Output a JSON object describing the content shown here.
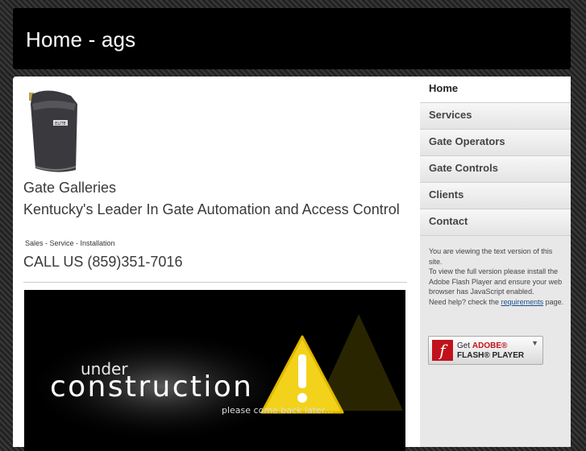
{
  "header": {
    "title": "Home - ags"
  },
  "main": {
    "heading": "Gate Galleries",
    "tagline": "Kentucky's Leader In Gate Automation and Access Control",
    "services_line": "Sales - Service - Installation",
    "phone": "CALL US (859)351-7016",
    "banner": {
      "line1": "under",
      "line2": "construction",
      "line3": "please come back later..."
    }
  },
  "sidebar": {
    "nav": [
      {
        "label": "Home",
        "active": true
      },
      {
        "label": "Services"
      },
      {
        "label": "Gate Operators"
      },
      {
        "label": "Gate Controls"
      },
      {
        "label": "Clients"
      },
      {
        "label": "Contact"
      }
    ],
    "flash_notice": {
      "line1": "You are viewing the text version of this site.",
      "line2": "To view the full version please install the Adobe Flash Player and ensure your web browser has JavaScript enabled.",
      "help_prefix": "Need help? check the",
      "help_link": "requirements",
      "help_suffix": "page."
    },
    "flash_badge": {
      "get": "Get",
      "adobe": "ADOBE®",
      "player": "FLASH® PLAYER",
      "logo": "f"
    }
  },
  "colors": {
    "accent_red": "#c1121b",
    "link": "#1a4f8c",
    "warning_yellow": "#f2d21a"
  }
}
